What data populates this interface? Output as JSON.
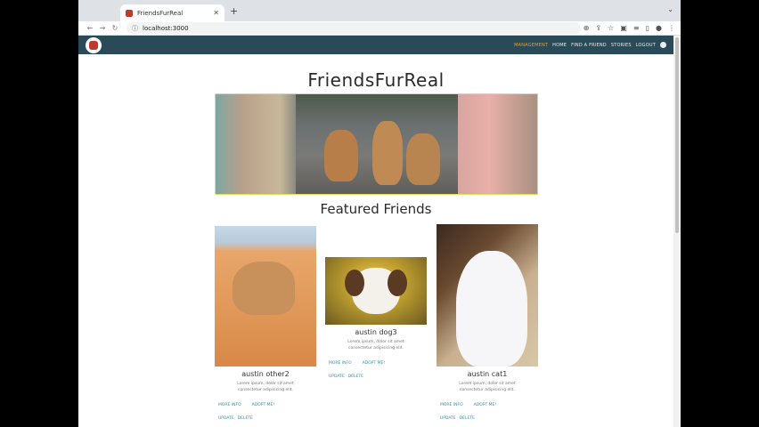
{
  "browser": {
    "tab_title": "FriendsFurReal",
    "url": "localhost:3000"
  },
  "navbar": {
    "links": [
      "MANAGEMENT",
      "HOME",
      "FIND A FRIEND",
      "STORIES",
      "LOGOUT"
    ],
    "active": "MANAGEMENT"
  },
  "site": {
    "title": "FriendsFurReal",
    "featured_heading": "Featured Friends"
  },
  "cards": [
    {
      "name": "austin other2",
      "description": "Lorem ipsum, dolor sit amet consectetur adipisicing elit.",
      "more_info": "MORE INFO",
      "adopt_me": "ADOPT ME!",
      "update": "UPDATE",
      "delete": "DELETE"
    },
    {
      "name": "austin dog3",
      "description": "Lorem ipsum, dolor sit amet consectetur adipisicing elit.",
      "more_info": "MORE INFO",
      "adopt_me": "ADOPT ME!",
      "update": "UPDATE",
      "delete": "DELETE"
    },
    {
      "name": "austin cat1",
      "description": "Lorem ipsum, dolor sit amet consectetur adipisicing elit.",
      "more_info": "MORE INFO",
      "adopt_me": "ADOPT ME!",
      "update": "UPDATE",
      "delete": "DELETE"
    }
  ],
  "colors": {
    "navbar": "#2a4a58",
    "link": "#3a8fb0",
    "active_nav": "#e0a040"
  }
}
